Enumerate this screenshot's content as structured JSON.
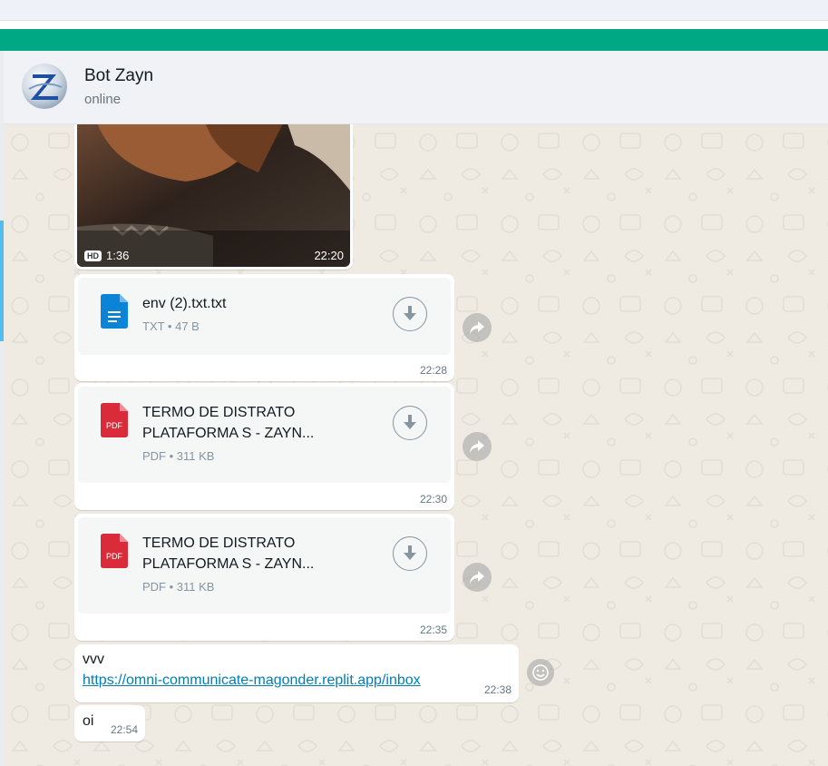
{
  "colors": {
    "accent": "#00a884",
    "bubble": "#ffffff",
    "link": "#027eb5",
    "pdf_red": "#d92b3a",
    "txt_blue": "#0b84d8"
  },
  "header": {
    "name": "Bot Zayn",
    "status": "online",
    "avatar_icon": "zayn-logo-avatar"
  },
  "video": {
    "hd": "HD",
    "duration": "1:36",
    "time": "22:20"
  },
  "documents": [
    {
      "title": "env (2).txt.txt",
      "meta": "TXT • 47 B",
      "icon": "txt-file-icon",
      "time": "22:28"
    },
    {
      "title": "TERMO DE DISTRATO PLATAFORMA S - ZAYN...",
      "icon_label": "PDF",
      "meta": "PDF • 311 KB",
      "icon": "pdf-file-icon",
      "time": "22:30"
    },
    {
      "title": "TERMO DE DISTRATO PLATAFORMA S - ZAYN...",
      "icon_label": "PDF",
      "meta": "PDF • 311 KB",
      "icon": "pdf-file-icon",
      "time": "22:35"
    }
  ],
  "messages": [
    {
      "text": "vvv",
      "link": "https://omni-communicate-magonder.replit.app/inbox",
      "time": "22:38"
    },
    {
      "text": "oi",
      "time": "22:54"
    }
  ]
}
